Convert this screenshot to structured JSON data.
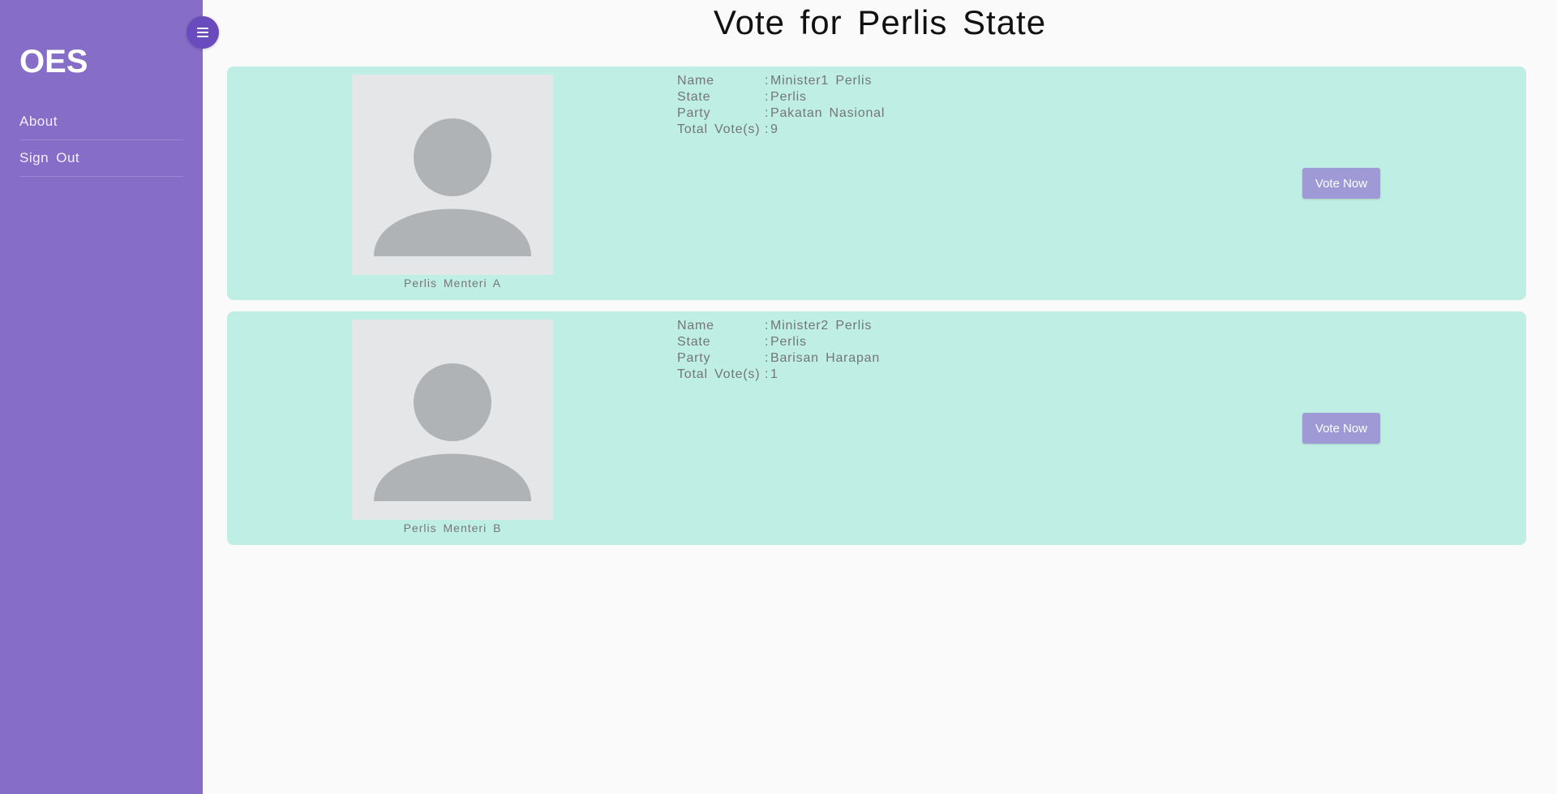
{
  "sidebar": {
    "brand": "OES",
    "items": [
      {
        "label": "About"
      },
      {
        "label": "Sign Out"
      }
    ]
  },
  "icons": {
    "toggle": "hamburger-menu-icon",
    "avatar": "user-placeholder-icon"
  },
  "page": {
    "title": "Vote for Perlis State"
  },
  "labels": {
    "name": "Name",
    "state": "State",
    "party": "Party",
    "votes": "Total Vote(s)",
    "separator": ":"
  },
  "candidates": [
    {
      "caption": "Perlis Menteri A",
      "name": "Minister1 Perlis",
      "state": "Perlis",
      "party": "Pakatan Nasional",
      "votes": "9",
      "button": "Vote Now"
    },
    {
      "caption": "Perlis Menteri B",
      "name": "Minister2 Perlis",
      "state": "Perlis",
      "party": "Barisan Harapan",
      "votes": "1",
      "button": "Vote Now"
    }
  ],
  "colors": {
    "sidebar": "#856dc8",
    "toggle": "#6a4bbd",
    "card": "#bfefe4",
    "button": "#9f9ad6",
    "avatar_bg": "#e5e6e8",
    "avatar_fg": "#b0b3b6"
  }
}
